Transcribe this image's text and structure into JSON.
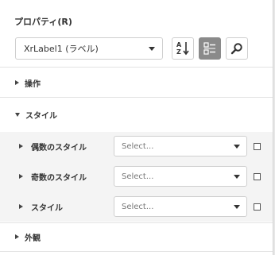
{
  "panel": {
    "title": "プロパティ(R)",
    "object_selector": {
      "value": "XrLabel1 (ラベル)"
    },
    "toolbar": {
      "sort_icon": "sort-alphabetical-icon",
      "categorized_icon": "categorized-view-icon",
      "search_icon": "search-icon"
    },
    "groups": [
      {
        "label": "操作",
        "expanded": false
      },
      {
        "label": "スタイル",
        "expanded": true
      },
      {
        "label": "外観",
        "expanded": false
      }
    ],
    "style_properties": [
      {
        "label": "偶数のスタイル",
        "placeholder": "Select...",
        "checked": false
      },
      {
        "label": "奇数のスタイル",
        "placeholder": "Select...",
        "checked": false
      },
      {
        "label": "スタイル",
        "placeholder": "Select...",
        "checked": false
      }
    ]
  }
}
